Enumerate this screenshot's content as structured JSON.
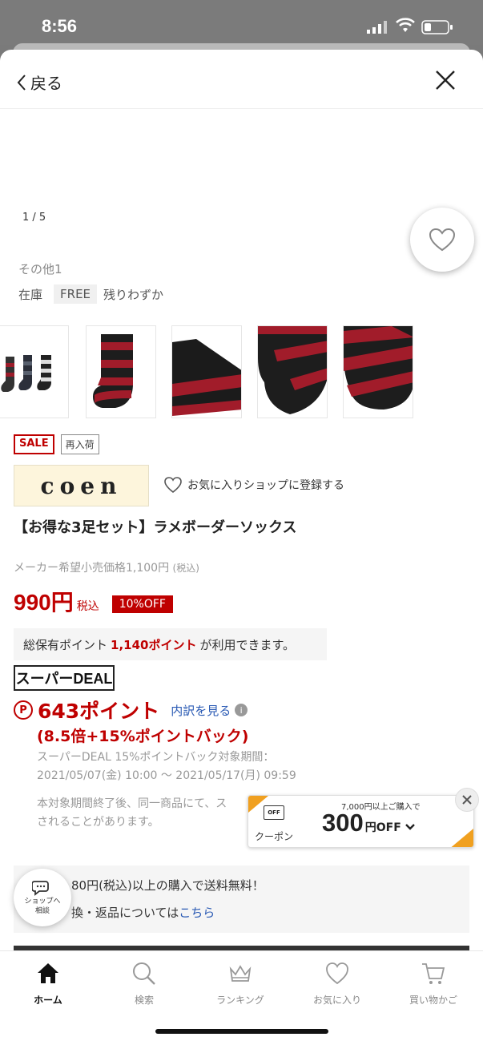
{
  "status": {
    "time": "8:56"
  },
  "header": {
    "back_label": "戻る"
  },
  "gallery": {
    "pager": "1 / 5"
  },
  "variant": {
    "option": "その他1",
    "stock_label": "在庫",
    "size": "FREE",
    "stock_status": "残りわずか"
  },
  "badges": {
    "sale": "SALE",
    "restock": "再入荷"
  },
  "shop": {
    "logo_text": "coen",
    "favorite_label": "お気に入りショップに登録する"
  },
  "product": {
    "title": "【お得な3足セット】ラメボーダーソックス",
    "list_price": "メーカー希望小売価格1,100円",
    "list_price_tax": "(税込)",
    "price": "990円",
    "price_tax": "税込",
    "discount": "10%OFF"
  },
  "points": {
    "prefix": "総保有ポイント",
    "amount": "1,140ポイント",
    "suffix": "が利用できます。",
    "deal_logo": "スーパーDEAL",
    "p_icon": "P",
    "earn": "643ポイント",
    "breakdown": "内訳を見る",
    "back_rate": "(8.5倍+15%ポイントバック)",
    "period_line1": "スーパーDEAL 15%ポイントバック対象期間：",
    "period_line2": "2021/05/07(金) 10:00 〜 2021/05/17(月) 09:59",
    "note_line1": "本対象期間終了後、同一商品にて、ス",
    "note_line2": "されることがあります。"
  },
  "coupon": {
    "icon_text": "OFF",
    "label": "クーポン",
    "condition": "7,000円以上ご購入で",
    "amount": "300",
    "unit": "円OFF"
  },
  "shipping": {
    "line1": "80円(税込)以上の購入で送料無料！",
    "line2_prefix": "換・返品については",
    "line2_link": "こちら"
  },
  "shop_chat": {
    "line1": "ショップへ",
    "line2": "相談"
  },
  "tabs": [
    {
      "label": "ホーム",
      "icon": "home-icon"
    },
    {
      "label": "検索",
      "icon": "search-icon"
    },
    {
      "label": "ランキング",
      "icon": "crown-icon"
    },
    {
      "label": "お気に入り",
      "icon": "heart-icon"
    },
    {
      "label": "買い物かご",
      "icon": "cart-icon"
    }
  ],
  "colors": {
    "accent": "#bf0000",
    "link": "#2a5ab4",
    "coupon": "#f0a020"
  }
}
